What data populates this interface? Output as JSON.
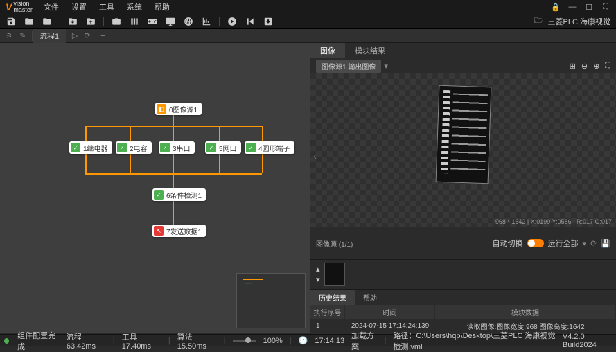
{
  "app": {
    "name_top": "vision",
    "name_bottom": "master"
  },
  "menu": {
    "file": "文件",
    "settings": "设置",
    "tools": "工具",
    "system": "系统",
    "help": "帮助"
  },
  "toolbar_right": {
    "label": "三菱PLC 海康视觉"
  },
  "flow_tab": {
    "name": "流程1"
  },
  "nodes": {
    "n0": "0图像源1",
    "n1": "1继电器",
    "n2": "2电容",
    "n3": "3串口",
    "n4": "5网口",
    "n5": "4圆形端子",
    "n6": "6条件检测1",
    "n7": "7发送数据1"
  },
  "right_tabs": {
    "image": "图像",
    "module": "模块结果"
  },
  "breadcrumb": {
    "text": "图像源1.输出图像"
  },
  "viewer": {
    "info": "968 * 1642  | X:0199  Y:0586 | R:017  G:017"
  },
  "thumb": {
    "label": "图像源 (1/1)",
    "auto": "自动切换",
    "run": "运行全部"
  },
  "bottom_tabs": {
    "history": "历史结果",
    "help": "帮助"
  },
  "table": {
    "headers": {
      "seq": "执行序号",
      "time": "时间",
      "data": "模块数据"
    },
    "rows": [
      {
        "seq": "1",
        "time": "2024-07-15 17:14:24:139",
        "data": "读取图像:图像宽度:968 图像高度:1642"
      }
    ]
  },
  "status": {
    "left": "组件配置完成",
    "flow": "流程  63.42ms",
    "tool": "工具  17.40ms",
    "alg": "算法  15.50ms",
    "zoom": "100%",
    "time": "17:14:13",
    "loading": "加载方案",
    "path": "路径：C:\\Users\\hqp\\Desktop\\三菱PLC 海康视觉检测.vml",
    "version": "V4.2.0 Build2024"
  }
}
